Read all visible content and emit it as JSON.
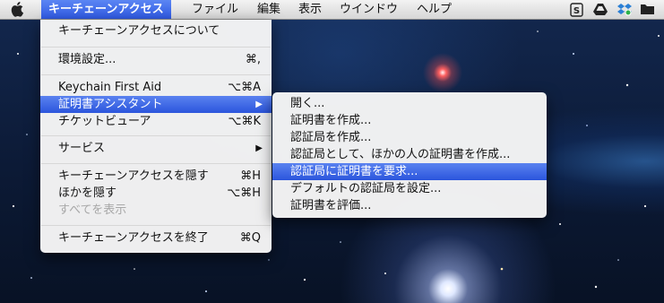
{
  "menubar": {
    "apple_icon": "apple-logo-icon",
    "items": [
      {
        "label": "キーチェーンアクセス",
        "active": true
      },
      {
        "label": "ファイル"
      },
      {
        "label": "編集"
      },
      {
        "label": "表示"
      },
      {
        "label": "ウインドウ"
      },
      {
        "label": "ヘルプ"
      }
    ],
    "status_icons": [
      "s-badge-icon",
      "drive-icon",
      "dropbox-icon",
      "folder-icon"
    ]
  },
  "app_menu": {
    "items": [
      {
        "label": "キーチェーンアクセスについて"
      },
      {
        "label": "環境設定...",
        "shortcut": "⌘,"
      },
      {
        "label": "Keychain First Aid",
        "shortcut": "⌥⌘A"
      },
      {
        "label": "証明書アシスタント",
        "arrow": "▶",
        "highlighted": true
      },
      {
        "label": "チケットビューア",
        "shortcut": "⌥⌘K"
      },
      {
        "label": "サービス",
        "arrow": "▶"
      },
      {
        "label": "キーチェーンアクセスを隠す",
        "shortcut": "⌘H"
      },
      {
        "label": "ほかを隠す",
        "shortcut": "⌥⌘H"
      },
      {
        "label": "すべてを表示",
        "disabled": true
      },
      {
        "label": "キーチェーンアクセスを終了",
        "shortcut": "⌘Q"
      }
    ]
  },
  "certificate_submenu": {
    "items": [
      {
        "label": "開く..."
      },
      {
        "label": "証明書を作成..."
      },
      {
        "label": "認証局を作成..."
      },
      {
        "label": "認証局として、ほかの人の証明書を作成..."
      },
      {
        "label": "認証局に証明書を要求...",
        "highlighted": true
      },
      {
        "label": "デフォルトの認証局を設定..."
      },
      {
        "label": "証明書を評価..."
      }
    ]
  }
}
